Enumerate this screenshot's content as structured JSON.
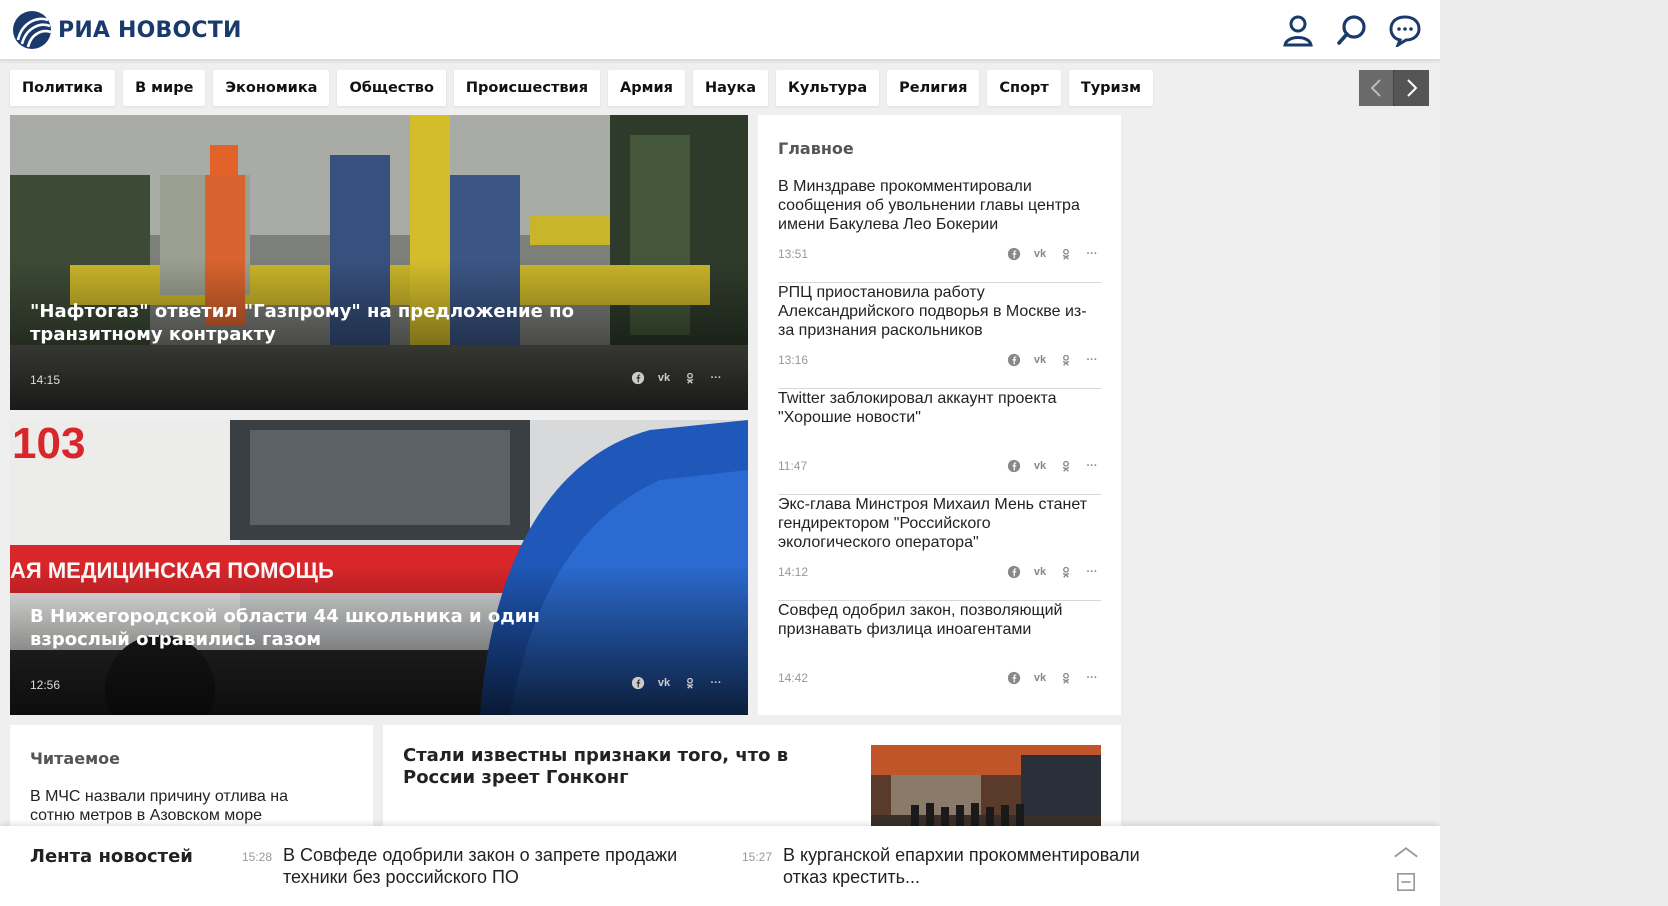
{
  "header": {
    "logo_text": "РИА НОВОСТИ",
    "icons": [
      "user-icon",
      "search-icon",
      "chat-icon"
    ]
  },
  "tabs": [
    "Политика",
    "В мире",
    "Экономика",
    "Общество",
    "Происшествия",
    "Армия",
    "Наука",
    "Культура",
    "Религия",
    "Спорт",
    "Туризм"
  ],
  "heroes": [
    {
      "title": "\"Нафтогаз\" ответил \"Газпрому\" на предложение по транзитному контракту",
      "time": "14:15"
    },
    {
      "title": "В Нижегородской области 44 школьника и один взрослый отравились газом",
      "time": "12:56",
      "image_text": {
        "number": "103",
        "banner": "АЯ МЕДИЦИНСКАЯ ПОМОЩЬ"
      }
    }
  ],
  "main": {
    "title": "Главное",
    "items": [
      {
        "text": "В Минздраве прокомментировали сообщения об увольнении главы центра имени Бакулева Лео Бокерии",
        "time": "13:51"
      },
      {
        "text": "РПЦ приостановила работу Александрийского подворья в Москве из-за признания раскольников",
        "time": "13:16"
      },
      {
        "text": "Twitter заблокировал аккаунт проекта \"Хорошие новости\"",
        "time": "11:47"
      },
      {
        "text": "Экс-глава Минстроя Михаил Мень станет гендиректором \"Российского экологического оператора\"",
        "time": "14:12"
      },
      {
        "text": "Совфед одобрил закон, позволяющий признавать физлица иноагентами",
        "time": "14:42"
      }
    ]
  },
  "reading": {
    "title": "Читаемое",
    "item": "В МЧС назвали причину отлива на сотню метров в Азовском море"
  },
  "story": {
    "title": "Стали известны признаки того, что в России зреет Гонконг"
  },
  "feed": {
    "title": "Лента новостей",
    "items": [
      {
        "time": "15:28",
        "text": "В Совфеде одобрили закон о запрете продажи техники без российского ПО"
      },
      {
        "time": "15:27",
        "text": "В курганской епархии прокомментировали отказ крестить..."
      }
    ]
  },
  "share_icons": [
    "facebook-icon",
    "vk-icon",
    "ok-icon",
    "more-icon"
  ]
}
